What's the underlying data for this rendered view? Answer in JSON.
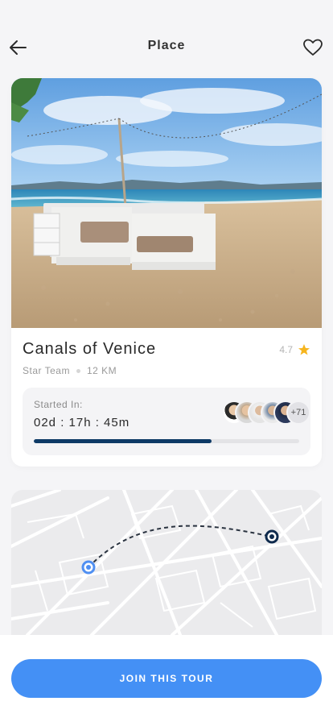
{
  "header": {
    "title": "Place",
    "back_icon": "arrow-left-icon",
    "favorite_icon": "heart-icon"
  },
  "place": {
    "name": "Canals of Venice",
    "rating": "4.7",
    "team": "Star Team",
    "distance": "12 KM"
  },
  "countdown": {
    "label": "Started In:",
    "time": "02d : 17h : 45m",
    "more_participants": "+71",
    "progress": 0.67
  },
  "map": {
    "route_icon_start": "location-dot-icon",
    "route_icon_end": "destination-dot-icon"
  },
  "footer": {
    "cta_label": "JOIN THIS TOUR"
  },
  "colors": {
    "accent": "#4490f5",
    "progress": "#0e3a66",
    "star": "#f6b51e"
  }
}
